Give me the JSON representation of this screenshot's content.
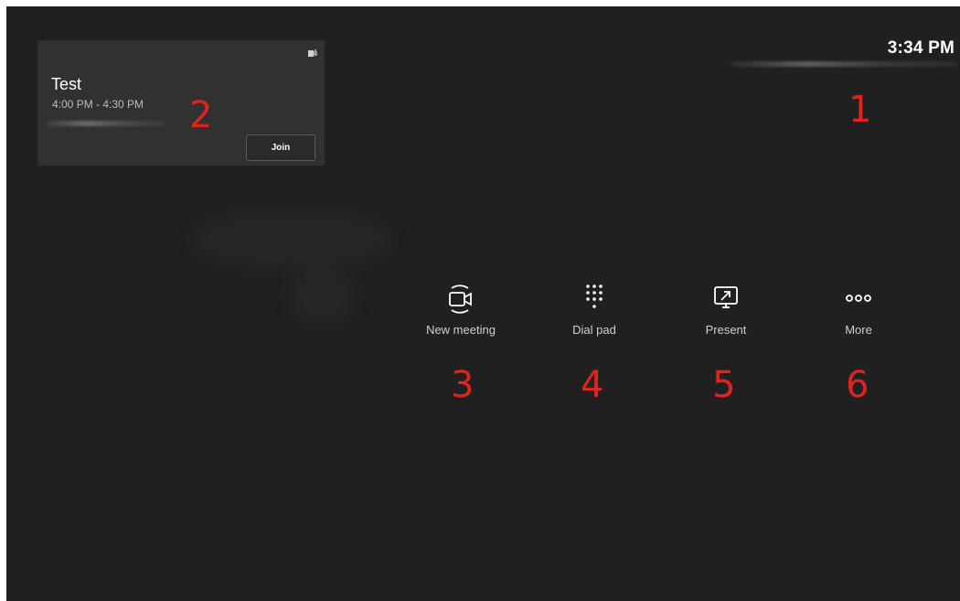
{
  "header": {
    "time": "3:34 PM"
  },
  "meeting_card": {
    "title": "Test",
    "time_range": "4:00 PM - 4:30 PM",
    "join_label": "Join",
    "app_icon": "teams-icon"
  },
  "actions": [
    {
      "label": "New meeting",
      "icon": "video-camera-icon"
    },
    {
      "label": "Dial pad",
      "icon": "dial-pad-icon"
    },
    {
      "label": "Present",
      "icon": "present-screen-icon"
    },
    {
      "label": "More",
      "icon": "more-dots-icon"
    }
  ],
  "callouts": [
    "1",
    "2",
    "3",
    "4",
    "5",
    "6"
  ],
  "colors": {
    "background": "#202020",
    "card": "#313131",
    "callout": "#e0231f",
    "text": "#ffffff"
  }
}
